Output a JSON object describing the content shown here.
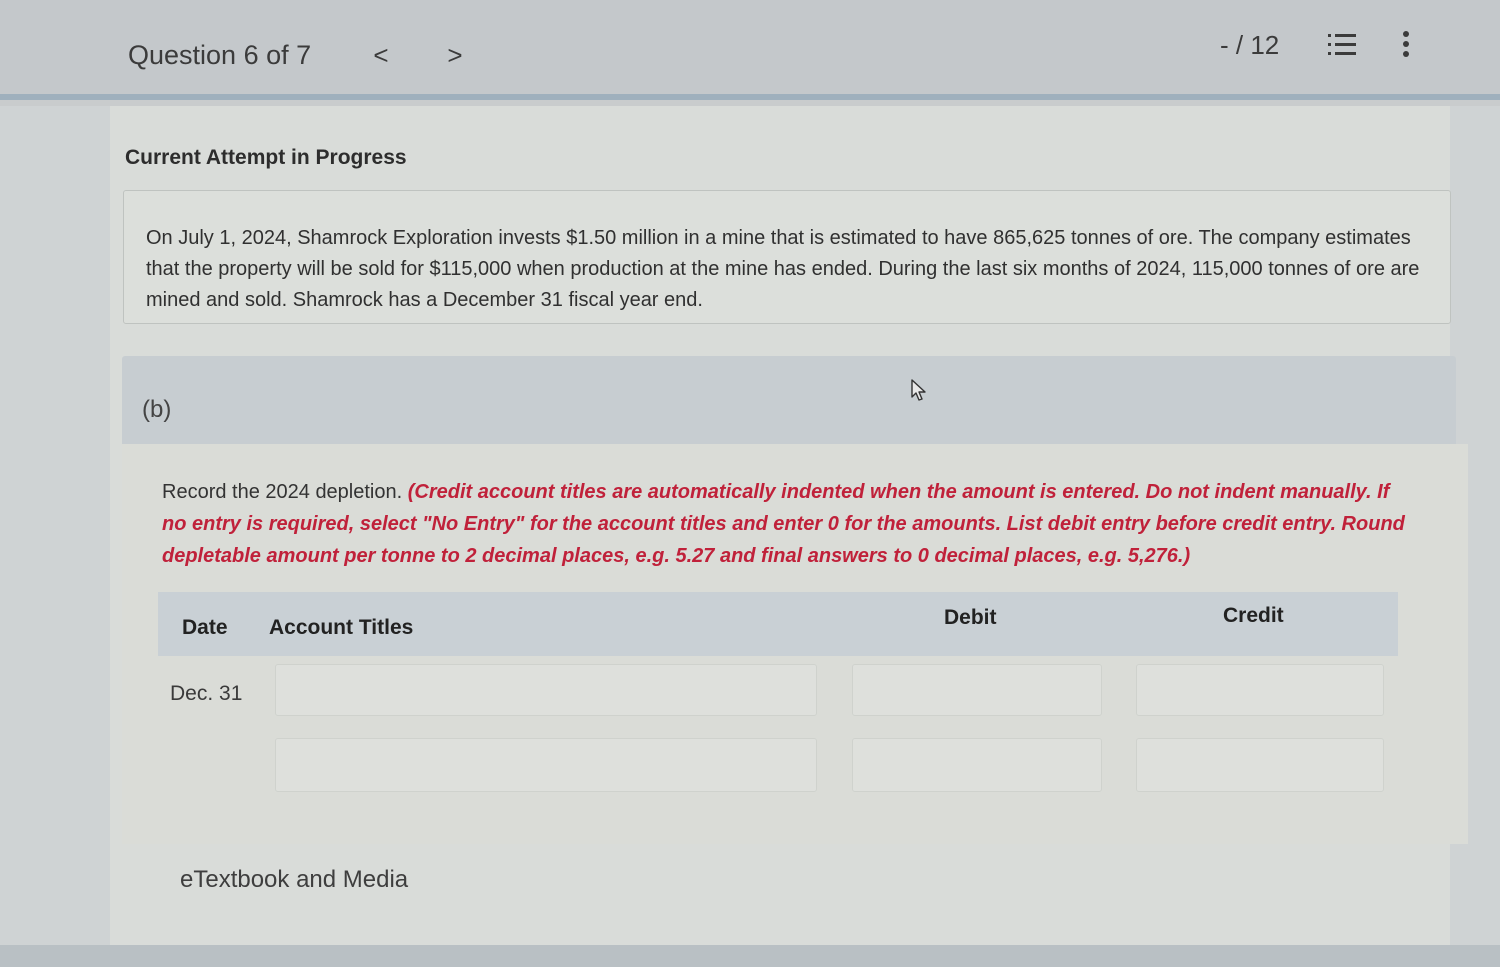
{
  "header": {
    "question_label": "Question 6 of 7",
    "prev_glyph": "<",
    "next_glyph": ">",
    "score": "- / 12"
  },
  "attempt_status": "Current Attempt in Progress",
  "problem_text": "On July 1, 2024, Shamrock Exploration invests $1.50 million in a mine that is estimated to have 865,625 tonnes of ore. The company estimates that the property will be sold for $115,000 when production at the mine has ended. During the last six months of 2024, 115,000 tonnes of ore are mined and sold. Shamrock has a December 31 fiscal year end.",
  "part": {
    "label": "(b)",
    "instruction_plain": "Record the 2024 depletion. ",
    "instruction_red": "(Credit account titles are automatically indented when the amount is entered. Do not indent manually. If no entry is required, select \"No Entry\" for the account titles and enter 0 for the amounts. List debit entry before credit entry. Round depletable amount per tonne to 2 decimal places, e.g. 5.27 and final answers to 0 decimal places, e.g. 5,276.)"
  },
  "journal_table": {
    "headers": {
      "date": "Date",
      "account": "Account Titles",
      "debit": "Debit",
      "credit": "Credit"
    },
    "rows": [
      {
        "date": "Dec. 31",
        "account": "",
        "debit": "",
        "credit": ""
      },
      {
        "date": "",
        "account": "",
        "debit": "",
        "credit": ""
      }
    ]
  },
  "etextbook_link": "eTextbook and Media",
  "icons": [
    "chevron-left-icon",
    "chevron-right-icon",
    "list-icon",
    "more-vertical-icon",
    "mouse-cursor-icon"
  ]
}
